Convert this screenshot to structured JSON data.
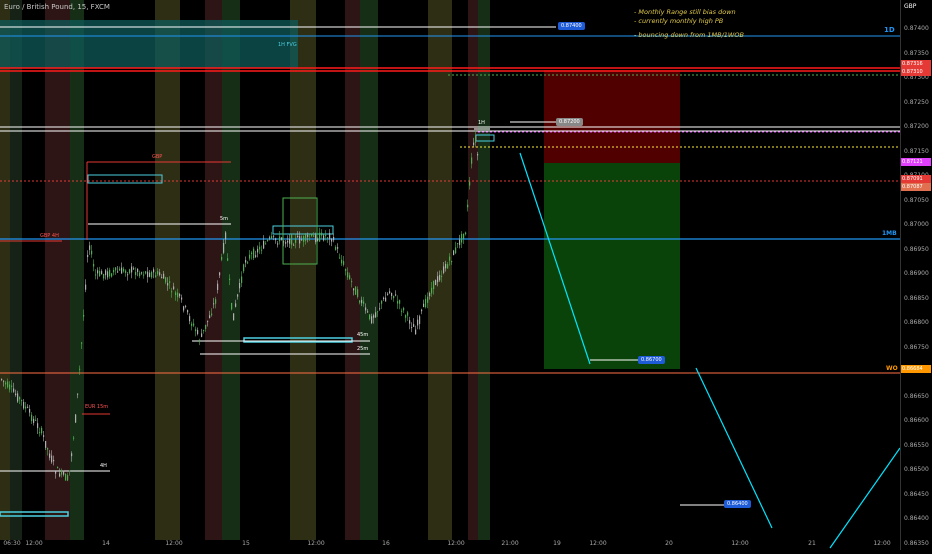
{
  "header": {
    "title": "Euro / British Pound, 15, FXCM"
  },
  "notes": [
    "- Monthly Range still bias down",
    "- currently monthly high PB",
    "- bouncing down from 1MB/1WOB"
  ],
  "axis": {
    "currency": "GBP",
    "ticks": [
      "0.87400",
      "0.87350",
      "0.87300",
      "0.87250",
      "0.87200",
      "0.87150",
      "0.87100",
      "0.87050",
      "0.87000",
      "0.86950",
      "0.86900",
      "0.86850",
      "0.86800",
      "0.86750",
      "0.86700",
      "0.86650",
      "0.86600",
      "0.86550",
      "0.86500",
      "0.86450",
      "0.86400",
      "0.86350"
    ],
    "x_ticks": [
      "06:30",
      "12:00",
      "14",
      "12:00",
      "15",
      "12:00",
      "16",
      "12:00",
      "21:00",
      "19",
      "12:00",
      "20",
      "12:00",
      "21",
      "12:00"
    ]
  },
  "levels": {
    "d1": "1D",
    "mb1": "1MB",
    "wo": "WO",
    "fvg_1h": "1H FVG",
    "gbp": "GBP",
    "gbp4h": "GBP 4H",
    "eur15m": "EUR 15m",
    "h4": "4H",
    "m5": "5m",
    "m45": "45m",
    "m25": "25m",
    "h1": "1H"
  },
  "price_tags": {
    "red_top": "0.87316",
    "red_2": "0.87310",
    "magenta": "0.87121",
    "current": "0.87091",
    "current_2": "0.87087",
    "wo_tag": "0.86684"
  },
  "callouts": {
    "top": "0.87400",
    "mid": "0.87200",
    "target": "0.86700",
    "bottom": "0.86400"
  },
  "colors": {
    "background": "#000000",
    "up_candle": "#4caf50",
    "down_candle": "#c0c0c0",
    "stop_zone": "#5a0000",
    "target_zone": "#0a4a0a",
    "blue_line": "#2196f3",
    "cyan": "#00e5ff",
    "red_line": "#ff1a1a",
    "magenta": "#e040fb"
  }
}
